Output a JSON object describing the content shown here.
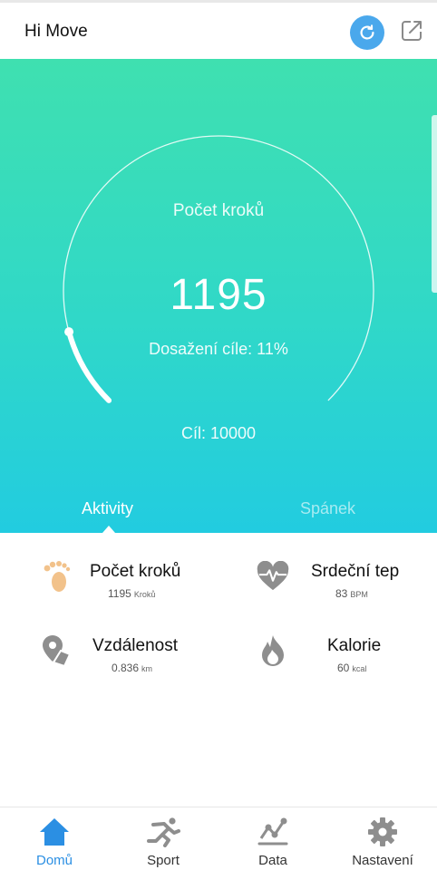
{
  "header": {
    "title": "Hi Move",
    "sync_icon": "sync-icon",
    "share_icon": "share-icon"
  },
  "summary": {
    "title": "Počet kroků",
    "steps": "1195",
    "goal_progress_text": "Dosažení cíle: 11%",
    "goal_text": "Cíl: 10000",
    "goal_progress": 0.11
  },
  "tabs": [
    {
      "label": "Aktivity",
      "active": true
    },
    {
      "label": "Spánek",
      "active": false
    }
  ],
  "stats": [
    {
      "name": "Počet kroků",
      "value": "1195",
      "unit": "Kroků",
      "icon": "footprints-icon",
      "color": "#f2c28b"
    },
    {
      "name": "Srdeční tep",
      "value": "83",
      "unit": "BPM",
      "icon": "heart-rate-icon",
      "color": "#8e8e8e"
    },
    {
      "name": "Vzdálenost",
      "value": "0.836",
      "unit": "km",
      "icon": "location-pin-icon",
      "color": "#8e8e8e"
    },
    {
      "name": "Kalorie",
      "value": "60",
      "unit": "kcal",
      "icon": "flame-icon",
      "color": "#8e8e8e"
    }
  ],
  "nav": [
    {
      "label": "Domů",
      "icon": "home-icon",
      "active": true
    },
    {
      "label": "Sport",
      "icon": "running-icon",
      "active": false
    },
    {
      "label": "Data",
      "icon": "chart-icon",
      "active": false
    },
    {
      "label": "Nastavení",
      "icon": "gear-icon",
      "active": false
    }
  ],
  "colors": {
    "accent": "#2b8fe3",
    "hero_top": "#3fe0b0",
    "hero_bottom": "#22cce0",
    "sync_button": "#4aa8ec"
  }
}
